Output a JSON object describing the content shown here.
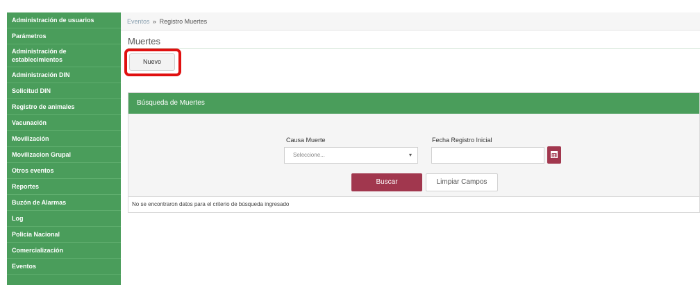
{
  "sidebar": {
    "items": [
      {
        "label": "Administración de usuarios"
      },
      {
        "label": "Parámetros"
      },
      {
        "label": "Administración de establecimientos"
      },
      {
        "label": "Administración DIN"
      },
      {
        "label": "Solicitud DIN"
      },
      {
        "label": "Registro de animales"
      },
      {
        "label": "Vacunación"
      },
      {
        "label": "Movilización"
      },
      {
        "label": "Movilizacion Grupal"
      },
      {
        "label": "Otros eventos"
      },
      {
        "label": "Reportes"
      },
      {
        "label": "Buzón de Alarmas"
      },
      {
        "label": "Log"
      },
      {
        "label": "Policia Nacional"
      },
      {
        "label": "Comercialización"
      },
      {
        "label": "Eventos"
      }
    ]
  },
  "breadcrumb": {
    "parent": "Eventos",
    "separator": "»",
    "current": "Registro Muertes"
  },
  "page": {
    "title": "Muertes",
    "new_button": "Nuevo"
  },
  "search_panel": {
    "title": "Búsqueda de Muertes",
    "cause_label": "Causa Muerte",
    "cause_value": "Seleccione...",
    "date_label": "Fecha Registro Inicial",
    "date_value": "",
    "search_button": "Buscar",
    "clear_button": "Limpiar Campos"
  },
  "results": {
    "message": "No se encontraron datos para el criterio de búsqueda ingresado"
  },
  "colors": {
    "sidebar_green": "#4a9d5b",
    "accent_maroon": "#a1374e",
    "highlight_red": "#e01010"
  }
}
